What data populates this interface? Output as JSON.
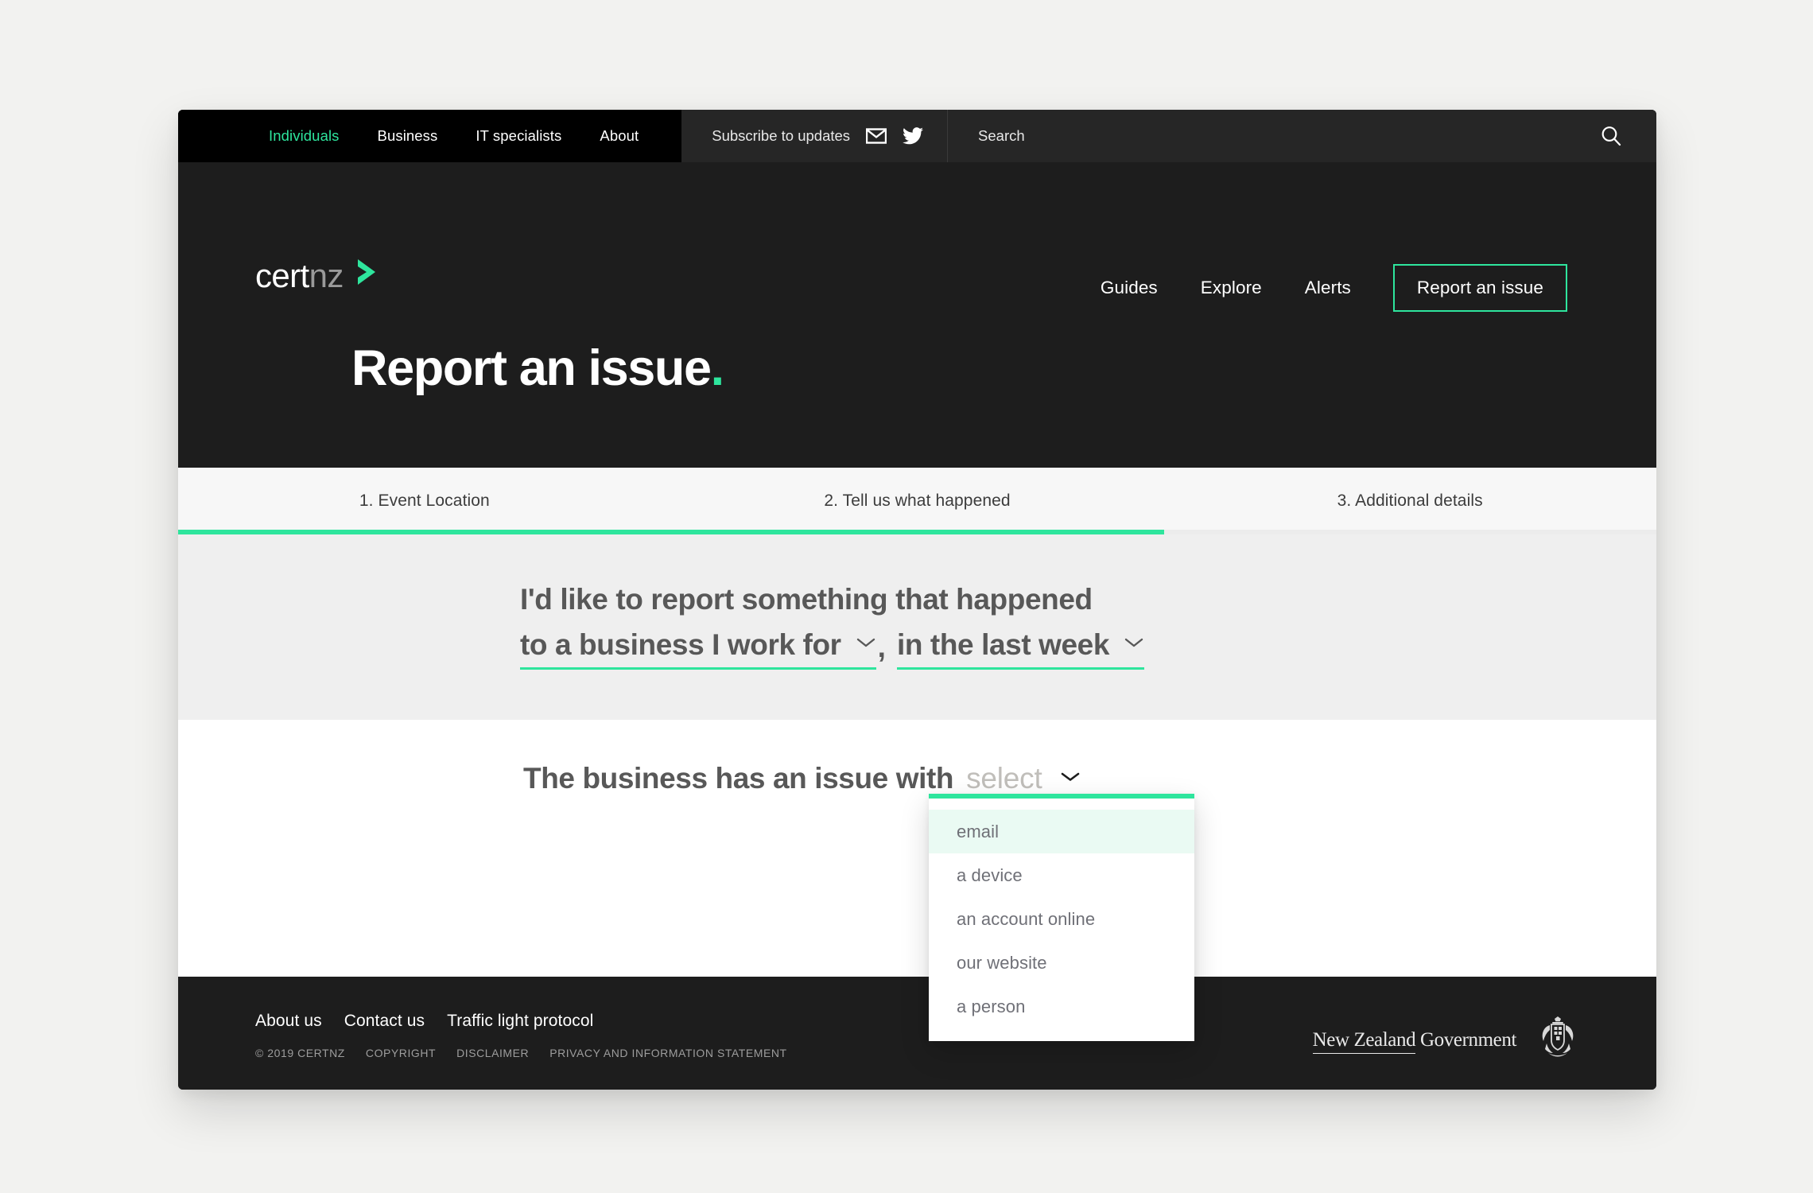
{
  "utility_bar": {
    "audience_links": [
      {
        "label": "Individuals",
        "active": true
      },
      {
        "label": "Business",
        "active": false
      },
      {
        "label": "IT specialists",
        "active": false
      },
      {
        "label": "About",
        "active": false
      }
    ],
    "subscribe_label": "Subscribe to updates",
    "mail_icon": "mail-icon",
    "twitter_icon": "twitter-icon",
    "search_label": "Search",
    "search_icon": "search-icon",
    "active_color": "#2ee59d"
  },
  "masthead": {
    "logo": {
      "part1": "cert",
      "part2": "nz",
      "mark": "chevron-mark"
    },
    "nav": [
      {
        "label": "Guides"
      },
      {
        "label": "Explore"
      },
      {
        "label": "Alerts"
      }
    ],
    "cta_label": "Report an issue",
    "page_title": "Report an issue",
    "page_title_dot": "."
  },
  "steps": {
    "items": [
      {
        "label": "1. Event Location"
      },
      {
        "label": "2. Tell us what happened"
      },
      {
        "label": "3. Additional details"
      }
    ],
    "progress_percent": 66.7,
    "progress_color": "#2ee59d"
  },
  "question_one": {
    "line1": "I'd like to report something that happened",
    "who_value": "to a business I work for",
    "comma": ",",
    "when_value": "in the last week",
    "chevron_icon": "chevron-down-icon"
  },
  "question_two": {
    "prefix": "The business has an issue with",
    "placeholder": "select",
    "chevron_icon": "chevron-down-icon",
    "options": [
      {
        "label": "email",
        "highlighted": true
      },
      {
        "label": "a device",
        "highlighted": false
      },
      {
        "label": "an account online",
        "highlighted": false
      },
      {
        "label": "our website",
        "highlighted": false
      },
      {
        "label": "a person",
        "highlighted": false
      }
    ]
  },
  "footer": {
    "links": [
      {
        "label": "About us"
      },
      {
        "label": "Contact us"
      },
      {
        "label": "Traffic light protocol"
      }
    ],
    "legal": [
      {
        "label": "© 2019 CERTNZ"
      },
      {
        "label": "COPYRIGHT"
      },
      {
        "label": "DISCLAIMER"
      },
      {
        "label": "PRIVACY AND INFORMATION STATEMENT"
      }
    ],
    "govt_underlined": "New Zealand",
    "govt_rest": " Government",
    "crest_icon": "nz-coat-of-arms-icon"
  }
}
